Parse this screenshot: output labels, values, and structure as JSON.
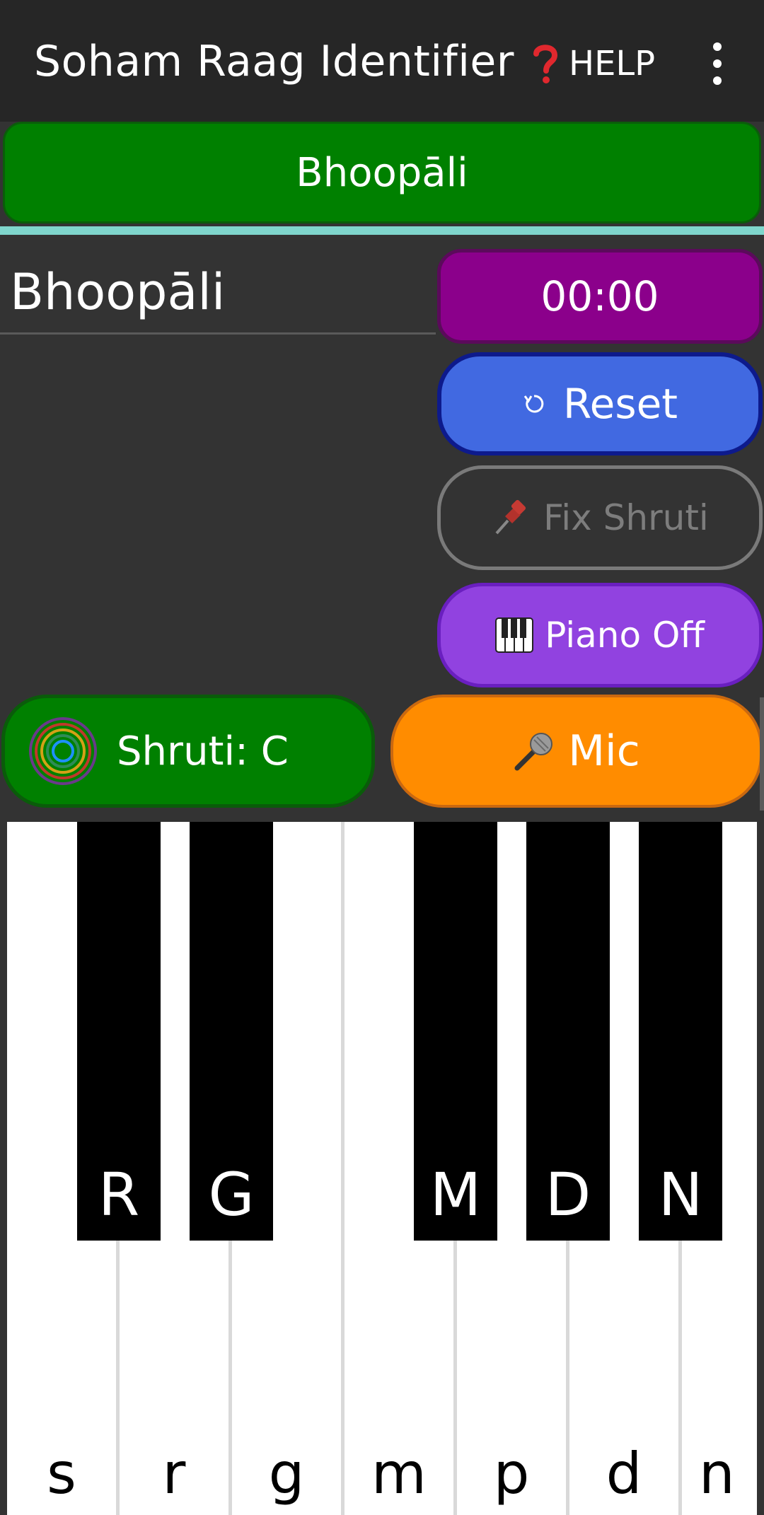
{
  "app_bar": {
    "title": "Soham Raag Identifier",
    "help_label": "HELP"
  },
  "raag_banner": {
    "label": "Bhoopāli"
  },
  "raag_field": {
    "value": "Bhoopāli"
  },
  "controls": {
    "timer": "00:00",
    "reset_label": "Reset",
    "fix_shruti_label": "Fix Shruti",
    "piano_label": "Piano Off",
    "shruti_label": "Shruti: C",
    "mic_label": "Mic"
  },
  "keyboard": {
    "white_keys": [
      "s",
      "r",
      "g",
      "m",
      "p",
      "d",
      "n"
    ],
    "black_keys": [
      "R",
      "G",
      "M",
      "D",
      "N"
    ]
  },
  "colors": {
    "banner_green": "#008000",
    "timer_purple": "#8b008b",
    "reset_blue": "#4169e1",
    "piano_purple": "#9142e0",
    "mic_orange": "#ff8c00",
    "teal_divider": "#7fd6cc"
  },
  "icons": {
    "help": "question-mark-icon",
    "menu": "kebab-menu-icon",
    "reset": "refresh-icon",
    "fix": "pushpin-icon",
    "piano": "piano-icon",
    "shruti": "circle-logo-icon",
    "mic": "microphone-icon"
  }
}
